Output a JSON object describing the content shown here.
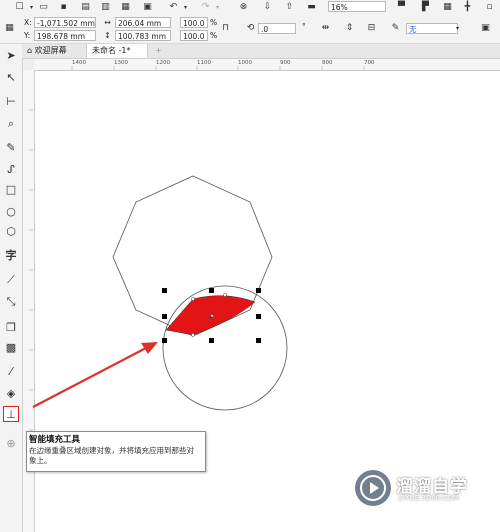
{
  "position": {
    "x_label": "X:",
    "x_value": "-1,071.502 mm",
    "y_label": "Y:",
    "y_value": "198.678 mm"
  },
  "size": {
    "width_value": "206.04 mm",
    "height_value": "100.783 mm"
  },
  "scale": {
    "x_percent": "100.0",
    "y_percent": "100.0",
    "unit": "%"
  },
  "rotation": {
    "value": ".0",
    "unit": "°"
  },
  "zoom": {
    "value": "16%"
  },
  "fill_select": {
    "value": "无"
  },
  "tabs": [
    {
      "label": "欢迎屏幕"
    },
    {
      "label": "未命名 -1*"
    }
  ],
  "ruler_ticks": [
    "1400",
    "1300",
    "1200",
    "1100",
    "1000",
    "900",
    "800",
    "700"
  ],
  "tooltip": {
    "title": "智能填充工具",
    "description": "在边缘重叠区域创建对象，并将填充应用到那些对象上。"
  },
  "watermark": {
    "name": "溜溜自学",
    "url": "ZIXUE.3D66.COM"
  },
  "colors": {
    "fill_red": "#e31414",
    "arrow_red": "#e0302a",
    "highlight_box": "#d9261c"
  },
  "icons": {
    "pick": "pick-tool-icon",
    "shape": "shape-tool-icon",
    "crop": "crop-tool-icon",
    "zoom": "zoom-tool-icon",
    "freehand": "freehand-tool-icon",
    "artistic": "artistic-media-icon",
    "rectangle": "rectangle-tool-icon",
    "ellipse": "ellipse-tool-icon",
    "polygon": "polygon-tool-icon",
    "text": "text-tool-icon",
    "dimension": "parallel-dimension-icon",
    "connector": "connector-tool-icon",
    "shadow": "drop-shadow-icon",
    "transparency": "transparency-icon",
    "eyedropper": "eyedropper-icon",
    "interactive_fill": "interactive-fill-icon",
    "smart_fill": "smart-fill-icon",
    "add": "add-tool-icon"
  }
}
